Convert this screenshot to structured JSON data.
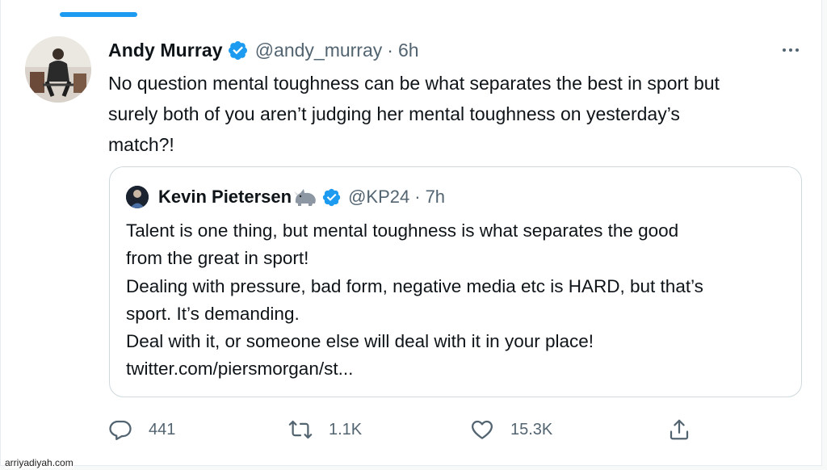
{
  "tweet": {
    "author_name": "Andy Murray",
    "handle": "@andy_murray",
    "separator": "·",
    "time": "6h",
    "text_lines": [
      "No question mental toughness can be what separates the best in sport but",
      "surely both of you aren’t judging her mental toughness on yesterday’s",
      "match?!"
    ]
  },
  "quoted": {
    "author_name": "Kevin Pietersen",
    "emoji": "rhino-emoji",
    "handle": "@KP24",
    "separator": "·",
    "time": "7h",
    "lines": [
      "Talent is one thing, but mental toughness is what separates the good",
      "from the great in sport!",
      "Dealing with pressure, bad form, negative media etc is HARD, but that’s",
      "sport. It’s demanding.",
      "Deal with it, or someone else will deal with it in your place!",
      "twitter.com/piersmorgan/st..."
    ]
  },
  "actions": {
    "reply_count": "441",
    "retweet_count": "1.1K",
    "like_count": "15.3K"
  },
  "icons": [
    "verified-badge-icon",
    "more-options-icon",
    "reply-icon",
    "retweet-icon",
    "like-icon",
    "share-icon"
  ],
  "colors": {
    "accent": "#1d9bf0",
    "secondary_text": "#536471",
    "border": "#cfd9de"
  },
  "watermark": "arriyadiyah.com"
}
